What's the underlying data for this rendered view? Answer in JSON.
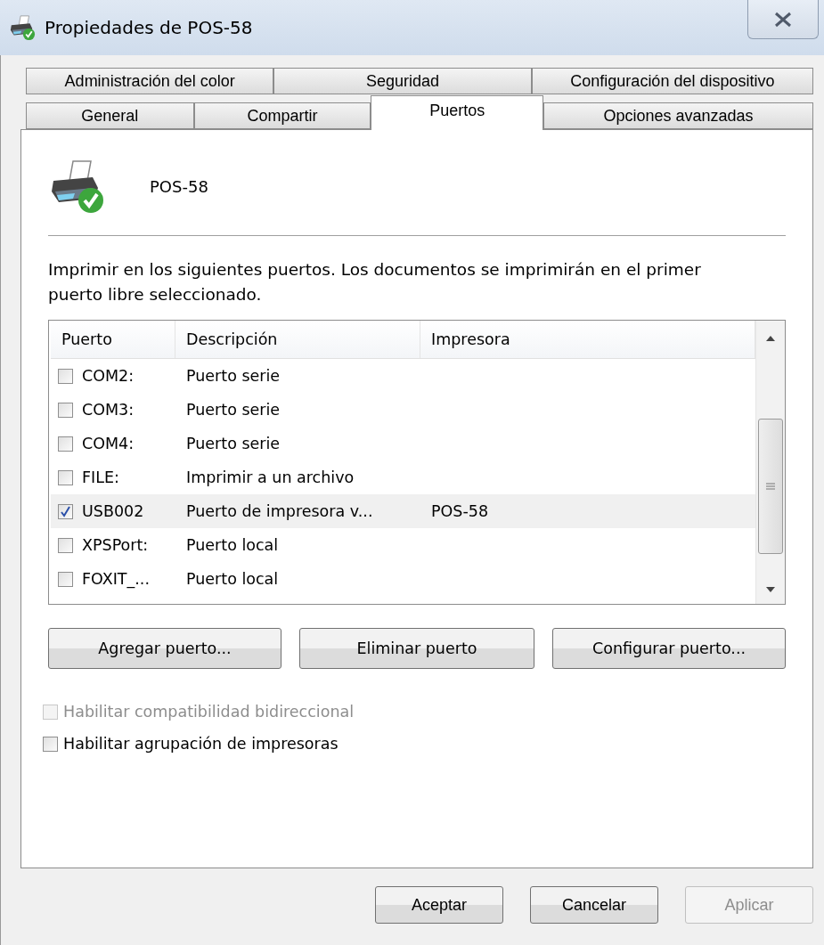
{
  "window": {
    "title": "Propiedades de POS-58"
  },
  "tabs": [
    [
      {
        "label": "Administración del color",
        "selected": false
      },
      {
        "label": "Seguridad",
        "selected": false
      },
      {
        "label": "Configuración del dispositivo",
        "selected": false
      }
    ],
    [
      {
        "label": "General",
        "selected": false
      },
      {
        "label": "Compartir",
        "selected": false
      },
      {
        "label": "Puertos",
        "selected": true
      },
      {
        "label": "Opciones avanzadas",
        "selected": false
      }
    ]
  ],
  "printer_name": "POS-58",
  "instructions": "Imprimir en los siguientes puertos. Los documentos se imprimirán en el primer puerto libre seleccionado.",
  "ports_table": {
    "columns": [
      "Puerto",
      "Descripción",
      "Impresora"
    ],
    "rows": [
      {
        "port": "COM2:",
        "description": "Puerto serie",
        "printer": "",
        "checked": false,
        "selected": false
      },
      {
        "port": "COM3:",
        "description": "Puerto serie",
        "printer": "",
        "checked": false,
        "selected": false
      },
      {
        "port": "COM4:",
        "description": "Puerto serie",
        "printer": "",
        "checked": false,
        "selected": false
      },
      {
        "port": "FILE:",
        "description": "Imprimir a un archivo",
        "printer": "",
        "checked": false,
        "selected": false
      },
      {
        "port": "USB002",
        "description": "Puerto de impresora v...",
        "printer": "POS-58",
        "checked": true,
        "selected": true
      },
      {
        "port": "XPSPort:",
        "description": "Puerto local",
        "printer": "",
        "checked": false,
        "selected": false
      },
      {
        "port": "FOXIT_...",
        "description": "Puerto local",
        "printer": "",
        "checked": false,
        "selected": false
      }
    ]
  },
  "port_buttons": [
    "Agregar puerto...",
    "Eliminar puerto",
    "Configurar puerto..."
  ],
  "options": [
    {
      "label": "Habilitar compatibilidad bidireccional",
      "checked": false,
      "disabled": true
    },
    {
      "label": "Habilitar agrupación de impresoras",
      "checked": false,
      "disabled": false
    }
  ],
  "dialog_buttons": [
    {
      "label": "Aceptar",
      "disabled": false
    },
    {
      "label": "Cancelar",
      "disabled": false
    },
    {
      "label": "Aplicar",
      "disabled": true
    }
  ]
}
